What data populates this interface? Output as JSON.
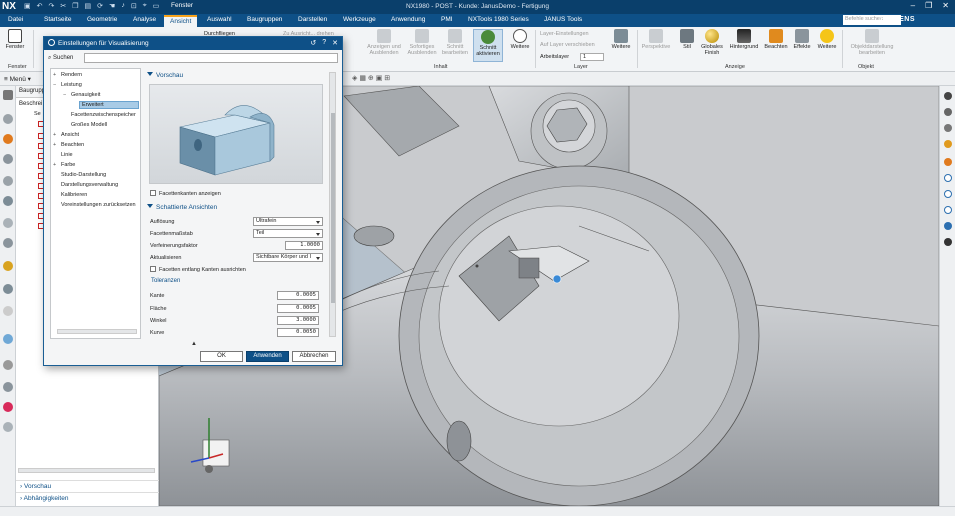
{
  "app": {
    "logo": "NX",
    "title": "NX1980 - POST - Kunde: JanusDemo - Fertigung",
    "fenster_label": "Fenster",
    "brand": "SIEMENS",
    "search_placeholder": "Befehle suchen"
  },
  "menu_tabs": [
    "Datei",
    "Startseite",
    "Geometrie",
    "Analyse",
    "Ansicht",
    "Auswahl",
    "Baugruppen",
    "Darstellen",
    "Werkzeuge",
    "Anwendung",
    "PMI",
    "NXTools 1980 Series",
    "JANUS Tools"
  ],
  "active_tab": "Ansicht",
  "ribbon": {
    "fenster_btn": "Fenster",
    "fenster_group": "Fenster",
    "durchfliegen": "Durchfliegen",
    "ausrichten": "Zu Ausricht... drehen",
    "anzeigen": "Anzeigen und Ausblenden",
    "sofortiges": "Sofortiges Ausblenden",
    "schnitt_bearbeiten": "Schnitt bearbeiten",
    "schnitt_aktivieren": "Schnitt aktivieren",
    "weitere1": "Weitere",
    "inhalt_group": "Inhalt",
    "layer_einstellungen": "Layer-Einstellungen",
    "auf_layer": "Auf Layer verschieben",
    "arbeitslayer_label": "Arbeitslayer",
    "arbeitslayer_value": "1",
    "weitere2": "Weitere",
    "layer_group": "Layer",
    "perspektive": "Perspektive",
    "stil": "Stil",
    "globales_finish": "Globales Finish",
    "hintergrund": "Hintergrund",
    "beachten": "Beachten",
    "effekte": "Effekte",
    "weitere3": "Weitere",
    "anzeige_group": "Anzeige",
    "objektdarstellung": "Objektdarstellung bearbeiten",
    "objekt_group": "Objekt"
  },
  "toolbar2": {
    "menu_label": "Menü"
  },
  "navigator": {
    "header": "Baugrupp",
    "subheader": "Beschrei",
    "root_label": "Se",
    "footer_items": [
      "Vorschau",
      "Abhängigkeiten"
    ]
  },
  "dialog": {
    "title": "Einstellungen für Visualisierung",
    "search_label": "Suchen",
    "tree": [
      {
        "label": "Rendern",
        "depth": 0,
        "pm": "+"
      },
      {
        "label": "Leistung",
        "depth": 0,
        "pm": "−"
      },
      {
        "label": "Genauigkeit",
        "depth": 1,
        "pm": "−"
      },
      {
        "label": "Erweitert",
        "depth": 2,
        "pm": "",
        "selected": true
      },
      {
        "label": "Facettenzwischenspeicher",
        "depth": 1,
        "pm": ""
      },
      {
        "label": "Großes Modell",
        "depth": 1,
        "pm": ""
      },
      {
        "label": "Ansicht",
        "depth": 0,
        "pm": "+"
      },
      {
        "label": "Beachten",
        "depth": 0,
        "pm": "+"
      },
      {
        "label": "Linie",
        "depth": 0,
        "pm": ""
      },
      {
        "label": "Farbe",
        "depth": 0,
        "pm": "+"
      },
      {
        "label": "Studio-Darstellung",
        "depth": 0,
        "pm": ""
      },
      {
        "label": "Darstellungsverwaltung",
        "depth": 0,
        "pm": ""
      },
      {
        "label": "Kalibrieren",
        "depth": 0,
        "pm": ""
      },
      {
        "label": "Voreinstellungen zurücksetzen",
        "depth": 0,
        "pm": ""
      }
    ],
    "vorschau_section": "Vorschau",
    "facettenkanten_label": "Facettenkanten anzeigen",
    "schattierte_section": "Schattierte Ansichten",
    "aufloesung_label": "Auflösung",
    "aufloesung_value": "Ultrafein",
    "facettenmassstab_label": "Facettenmaßstab",
    "facettenmassstab_value": "Teil",
    "verfeinerung_label": "Verfeinerungsfaktor",
    "verfeinerung_value": "1.0000",
    "aktualisieren_label": "Aktualisieren",
    "aktualisieren_value": "Sichtbare Körper und I",
    "facetten_kanten_label": "Facetten entlang Kanten ausrichten",
    "toleranzen_section": "Toleranzen",
    "kante_label": "Kante",
    "kante_value": "0.0005",
    "flaeche_label": "Fläche",
    "flaeche_value": "0.0005",
    "winkel_label": "Winkel",
    "winkel_value": "3.0000",
    "kurve_label": "Kurve",
    "kurve_value": "0.0050",
    "ok": "OK",
    "apply": "Anwenden",
    "cancel": "Abbrechen"
  },
  "viewport": {
    "marker": "RX"
  },
  "colors": {
    "title_bar": "#0a3f6b",
    "tab_bar": "#0e5087",
    "accent": "#f7a21b",
    "model": "#c7c9cc",
    "background": "#b5c1cc"
  }
}
